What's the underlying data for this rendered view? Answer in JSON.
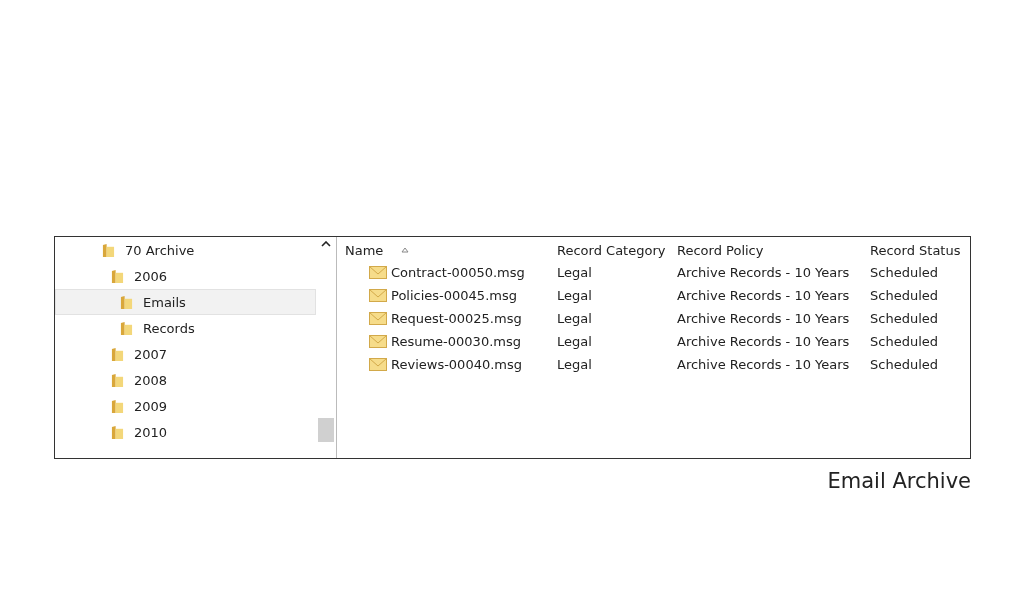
{
  "tree": [
    {
      "label": "70 Archive",
      "selected": false,
      "children": [
        {
          "label": "2006",
          "selected": false,
          "children": [
            {
              "label": "Emails",
              "selected": true
            },
            {
              "label": "Records",
              "selected": false
            }
          ]
        },
        {
          "label": "2007",
          "selected": false
        },
        {
          "label": "2008",
          "selected": false
        },
        {
          "label": "2009",
          "selected": false
        },
        {
          "label": "2010",
          "selected": false
        }
      ]
    }
  ],
  "table": {
    "columns": [
      "Name",
      "Record Category",
      "Record Policy",
      "Record Status"
    ],
    "rows": [
      {
        "name": "Contract-00050.msg",
        "category": "Legal",
        "policy": "Archive Records - 10 Years",
        "status": "Scheduled"
      },
      {
        "name": "Policies-00045.msg",
        "category": "Legal",
        "policy": "Archive Records - 10 Years",
        "status": "Scheduled"
      },
      {
        "name": "Request-00025.msg",
        "category": "Legal",
        "policy": "Archive Records - 10 Years",
        "status": "Scheduled"
      },
      {
        "name": "Resume-00030.msg",
        "category": "Legal",
        "policy": "Archive Records - 10 Years",
        "status": "Scheduled"
      },
      {
        "name": "Reviews-00040.msg",
        "category": "Legal",
        "policy": "Archive Records - 10 Years",
        "status": "Scheduled"
      }
    ]
  },
  "caption": "Email Archive"
}
